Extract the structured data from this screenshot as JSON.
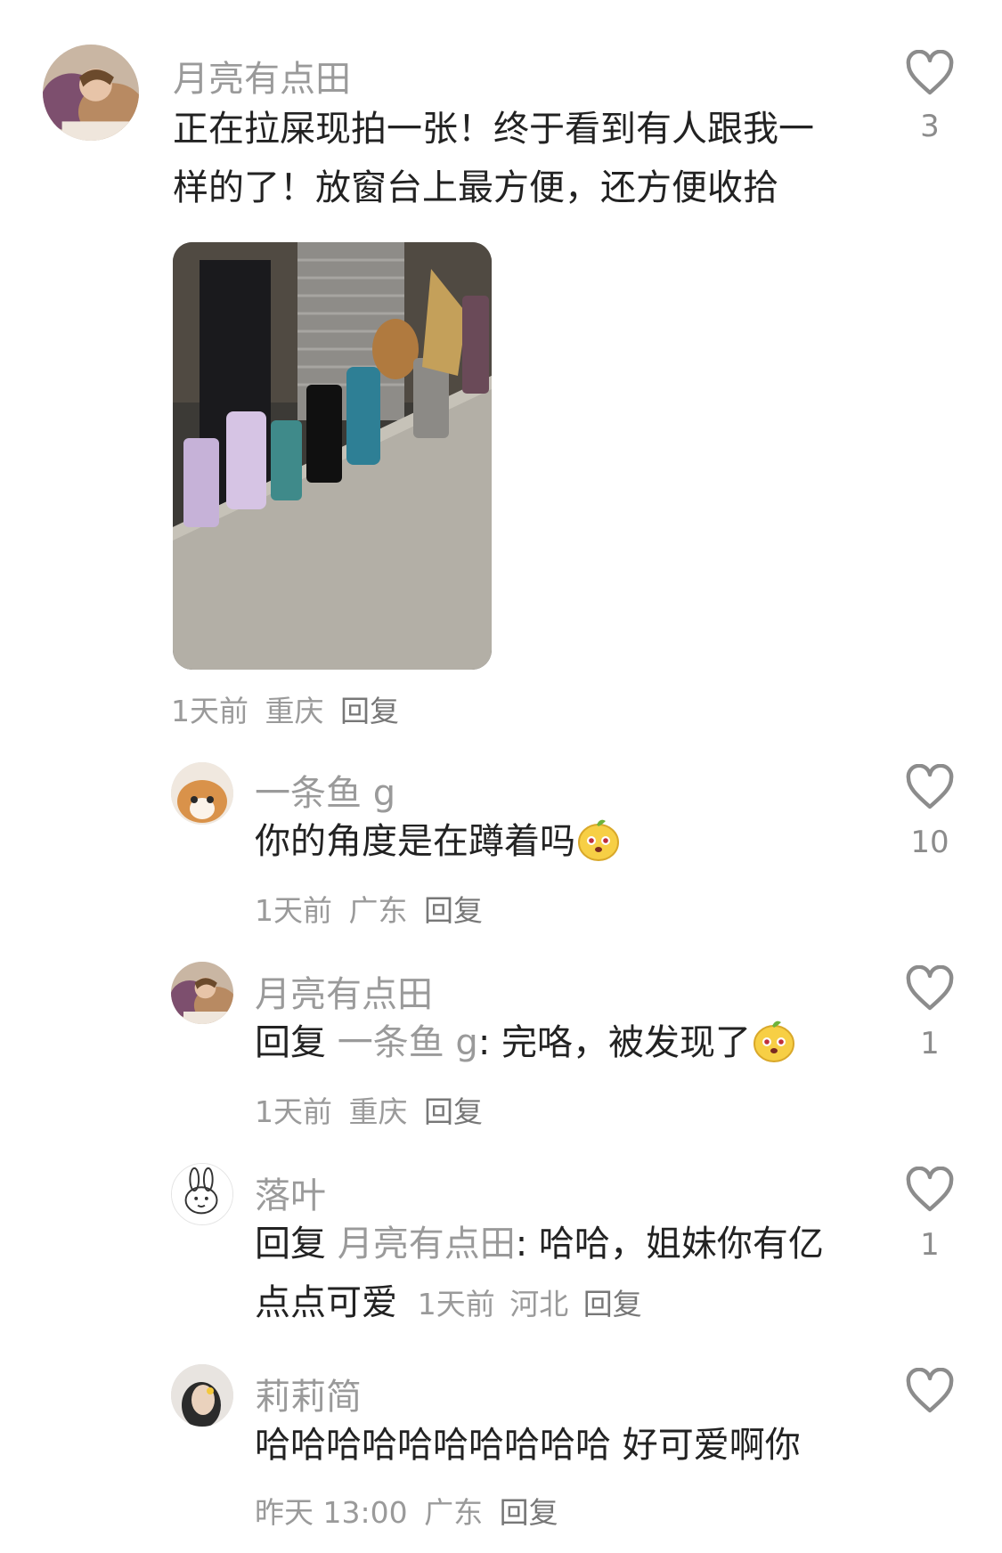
{
  "comments": [
    {
      "user": "月亮有点田",
      "text_line1": "正在拉屎现拍一张！终于看到有人跟我一",
      "text_line2": "样的了！放窗台上最方便，还方便收拾",
      "time": "1天前",
      "location": "重庆",
      "reply_label": "回复",
      "likes": "3"
    },
    {
      "user": "一条鱼 g",
      "text": "你的角度是在蹲着吗",
      "time": "1天前",
      "location": "广东",
      "reply_label": "回复",
      "likes": "10"
    },
    {
      "user": "月亮有点田",
      "reply_prefix": "回复",
      "mention": "一条鱼 g",
      "text": ": 完咯，被发现了",
      "time": "1天前",
      "location": "重庆",
      "reply_label": "回复",
      "likes": "1"
    },
    {
      "user": "落叶",
      "reply_prefix": "回复",
      "mention": "月亮有点田",
      "text_line1": ": 哈哈，姐妹你有亿",
      "text_line2": "点点可爱",
      "time": "1天前",
      "location": "河北",
      "reply_label": "回复",
      "likes": "1"
    },
    {
      "user": "莉莉简",
      "text": "哈哈哈哈哈哈哈哈哈哈 好可爱啊你",
      "time": "昨天 13:00",
      "location": "广东",
      "reply_label": "回复",
      "likes": ""
    }
  ],
  "icons": {
    "like": "heart-outline-icon",
    "emoji": "pear-face-emoji"
  },
  "colors": {
    "meta": "#9a9a9a",
    "text": "#222222",
    "heart": "#8c8c8c"
  }
}
